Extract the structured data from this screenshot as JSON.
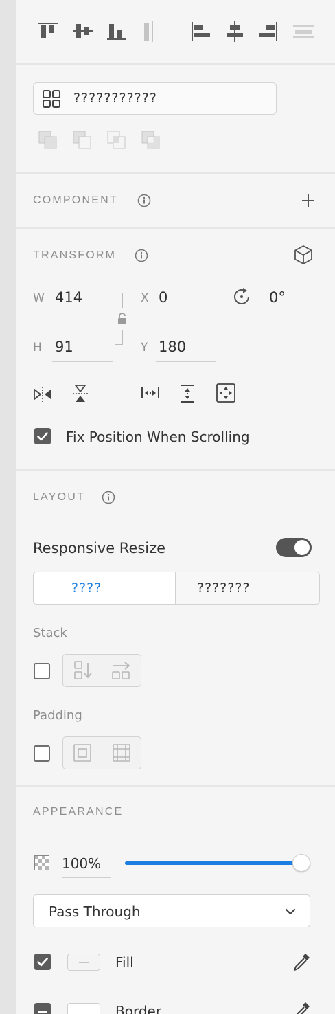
{
  "align": {
    "icons": [
      "align-top-icon",
      "align-middle-icon",
      "align-bottom-icon",
      "distribute-vertical-icon",
      "align-left-icon",
      "align-center-icon",
      "align-right-icon",
      "distribute-horizontal-icon"
    ]
  },
  "repeat_grid": {
    "label": "???????????"
  },
  "boolean_ops": [
    "union-icon",
    "subtract-icon",
    "intersect-icon",
    "exclude-icon"
  ],
  "component": {
    "title": "COMPONENT"
  },
  "transform": {
    "title": "TRANSFORM",
    "w_label": "W",
    "w_value": "414",
    "x_label": "X",
    "x_value": "0",
    "rotation_value": "0°",
    "h_label": "H",
    "h_value": "91",
    "y_label": "Y",
    "y_value": "180",
    "fix_position_label": "Fix Position When Scrolling",
    "fix_position_checked": true
  },
  "layout": {
    "title": "LAYOUT",
    "responsive_label": "Responsive Resize",
    "responsive_on": true,
    "seg_left": "????",
    "seg_right": "???????",
    "stack_label": "Stack",
    "padding_label": "Padding"
  },
  "appearance": {
    "title": "APPEARANCE",
    "opacity_value": "100%",
    "opacity": 1.0,
    "blend_mode": "Pass Through",
    "fill_label": "Fill",
    "border_label": "Border"
  },
  "colors": {
    "accent": "#1a7fe0",
    "icon": "#5a5a5a",
    "icon_light": "#bdbdbd"
  }
}
